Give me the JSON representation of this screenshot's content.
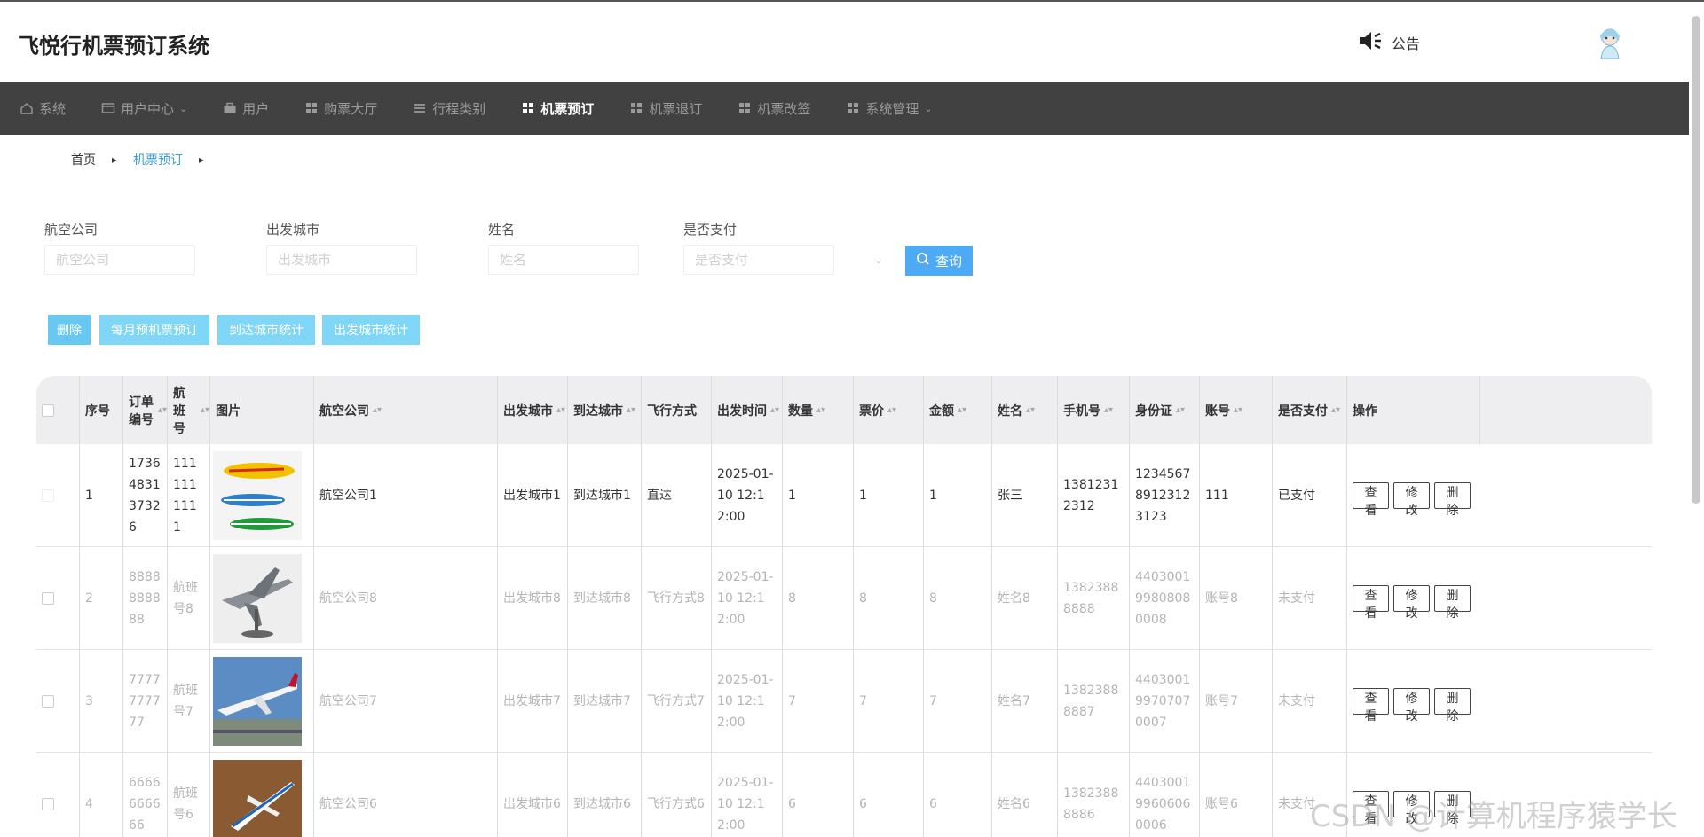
{
  "app": {
    "title": "飞悦行机票预订系统",
    "notice_label": "公告"
  },
  "nav": [
    {
      "label": "系统",
      "icon": "home-icon"
    },
    {
      "label": "用户中心",
      "icon": "user-card-icon",
      "dropdown": true
    },
    {
      "label": "用户",
      "icon": "briefcase-icon"
    },
    {
      "label": "购票大厅",
      "icon": "grid-icon"
    },
    {
      "label": "行程类别",
      "icon": "list-icon"
    },
    {
      "label": "机票预订",
      "icon": "grid-icon",
      "active": true
    },
    {
      "label": "机票退订",
      "icon": "grid-icon"
    },
    {
      "label": "机票改签",
      "icon": "grid-icon"
    },
    {
      "label": "系统管理",
      "icon": "grid-icon",
      "dropdown": true
    }
  ],
  "breadcrumb": {
    "home": "首页",
    "current": "机票预订"
  },
  "filters": [
    {
      "label": "航空公司",
      "placeholder": "航空公司"
    },
    {
      "label": "出发城市",
      "placeholder": "出发城市"
    },
    {
      "label": "姓名",
      "placeholder": "姓名"
    },
    {
      "label": "是否支付",
      "placeholder": "是否支付"
    }
  ],
  "query_label": "查询",
  "actions": [
    "删除",
    "每月预机票预订",
    "到达城市统计",
    "出发城市统计"
  ],
  "columns": [
    "序号",
    "订单编号",
    "航班号",
    "图片",
    "航空公司",
    "出发城市",
    "到达城市",
    "飞行方式",
    "出发时间",
    "数量",
    "票价",
    "金额",
    "姓名",
    "手机号",
    "身份证",
    "账号",
    "是否支付",
    "操作"
  ],
  "sortable": [
    false,
    true,
    true,
    false,
    true,
    true,
    true,
    false,
    true,
    true,
    true,
    true,
    true,
    true,
    true,
    true,
    true,
    false
  ],
  "rows": [
    {
      "no": "1",
      "order": "1736483137326",
      "flight": "1111111111",
      "image": "toy-planes",
      "airline": "航空公司1",
      "from": "出发城市1",
      "to": "到达城市1",
      "mode": "直达",
      "time": "2025-01-10 12:12:00",
      "qty": "1",
      "price": "1",
      "amount": "1",
      "name": "张三",
      "phone": "13812312312",
      "idcard": "123456789123123123",
      "account": "111",
      "paid": "已支付",
      "faded": false
    },
    {
      "no": "2",
      "order": "8888888888",
      "flight": "航班号8",
      "image": "fighter-jet",
      "airline": "航空公司8",
      "from": "出发城市8",
      "to": "到达城市8",
      "mode": "飞行方式8",
      "time": "2025-01-10 12:12:00",
      "qty": "8",
      "price": "8",
      "amount": "8",
      "name": "姓名8",
      "phone": "13823888888",
      "idcard": "440300199808080008",
      "account": "账号8",
      "paid": "未支付",
      "faded": true
    },
    {
      "no": "3",
      "order": "7777777777",
      "flight": "航班号7",
      "image": "airliner-sky",
      "airline": "航空公司7",
      "from": "出发城市7",
      "to": "到达城市7",
      "mode": "飞行方式7",
      "time": "2025-01-10 12:12:00",
      "qty": "7",
      "price": "7",
      "amount": "7",
      "name": "姓名7",
      "phone": "13823888887",
      "idcard": "440300199707070007",
      "account": "账号7",
      "paid": "未支付",
      "faded": true
    },
    {
      "no": "4",
      "order": "6666666666",
      "flight": "航班号6",
      "image": "model-plane",
      "airline": "航空公司6",
      "from": "出发城市6",
      "to": "到达城市6",
      "mode": "飞行方式6",
      "time": "2025-01-10 12:12:00",
      "qty": "6",
      "price": "6",
      "amount": "6",
      "name": "姓名6",
      "phone": "13823888886",
      "idcard": "440300199606060006",
      "account": "账号6",
      "paid": "未支付",
      "faded": true
    }
  ],
  "row_ops": [
    "查看",
    "修改",
    "删除"
  ],
  "watermark": "CSDN @计算机程序猿学长",
  "colors": {
    "nav_bg": "#414141",
    "query_btn": "#4faaf5",
    "action_btn": "#7fd6f7",
    "link": "#3a9bd5",
    "header_row": "#eeeef0"
  }
}
